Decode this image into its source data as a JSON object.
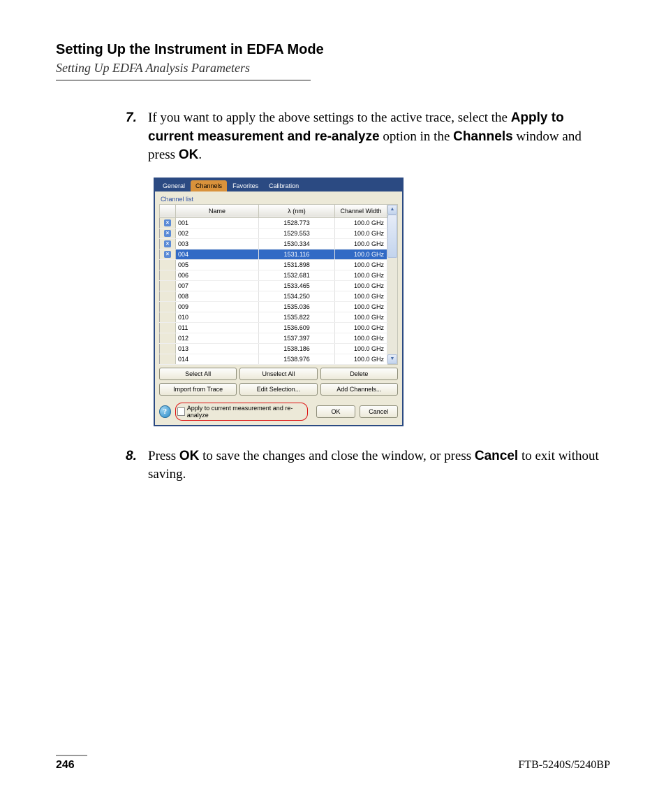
{
  "header": {
    "title": "Setting Up the Instrument in EDFA Mode",
    "subtitle": "Setting Up EDFA Analysis Parameters"
  },
  "steps": {
    "s7": {
      "num": "7.",
      "t1": "If you want to apply the above settings to the active trace, select the ",
      "b1": "Apply to current measurement and re-analyze",
      "t2": " option in the ",
      "b2": "Channels",
      "t3": " window and press ",
      "b3": "OK",
      "t4": "."
    },
    "s8": {
      "num": "8.",
      "t1": "Press ",
      "b1": "OK",
      "t2": " to save the changes and close the window, or press ",
      "b2": "Cancel",
      "t3": " to exit without saving."
    }
  },
  "dialog": {
    "tabs": [
      "General",
      "Channels",
      "Favorites",
      "Calibration"
    ],
    "activeTab": 1,
    "group_label": "Channel list",
    "columns": {
      "sel": "",
      "name": "Name",
      "lambda": "λ (nm)",
      "width": "Channel Width"
    },
    "rows": [
      {
        "marked": true,
        "selected": false,
        "name": "001",
        "lambda": "1528.773",
        "width": "100.0 GHz"
      },
      {
        "marked": true,
        "selected": false,
        "name": "002",
        "lambda": "1529.553",
        "width": "100.0 GHz"
      },
      {
        "marked": true,
        "selected": false,
        "name": "003",
        "lambda": "1530.334",
        "width": "100.0 GHz"
      },
      {
        "marked": true,
        "selected": true,
        "name": "004",
        "lambda": "1531.116",
        "width": "100.0 GHz"
      },
      {
        "marked": false,
        "selected": false,
        "name": "005",
        "lambda": "1531.898",
        "width": "100.0 GHz"
      },
      {
        "marked": false,
        "selected": false,
        "name": "006",
        "lambda": "1532.681",
        "width": "100.0 GHz"
      },
      {
        "marked": false,
        "selected": false,
        "name": "007",
        "lambda": "1533.465",
        "width": "100.0 GHz"
      },
      {
        "marked": false,
        "selected": false,
        "name": "008",
        "lambda": "1534.250",
        "width": "100.0 GHz"
      },
      {
        "marked": false,
        "selected": false,
        "name": "009",
        "lambda": "1535.036",
        "width": "100.0 GHz"
      },
      {
        "marked": false,
        "selected": false,
        "name": "010",
        "lambda": "1535.822",
        "width": "100.0 GHz"
      },
      {
        "marked": false,
        "selected": false,
        "name": "011",
        "lambda": "1536.609",
        "width": "100.0 GHz"
      },
      {
        "marked": false,
        "selected": false,
        "name": "012",
        "lambda": "1537.397",
        "width": "100.0 GHz"
      },
      {
        "marked": false,
        "selected": false,
        "name": "013",
        "lambda": "1538.186",
        "width": "100.0 GHz"
      },
      {
        "marked": false,
        "selected": false,
        "name": "014",
        "lambda": "1538.976",
        "width": "100.0 GHz"
      }
    ],
    "buttons": {
      "select_all": "Select All",
      "unselect_all": "Unselect All",
      "delete": "Delete",
      "import": "Import from Trace",
      "edit": "Edit Selection...",
      "add": "Add Channels..."
    },
    "checkbox_label": "Apply to current measurement and re-analyze",
    "ok": "OK",
    "cancel": "Cancel"
  },
  "footer": {
    "page": "246",
    "model": "FTB-5240S/5240BP"
  }
}
